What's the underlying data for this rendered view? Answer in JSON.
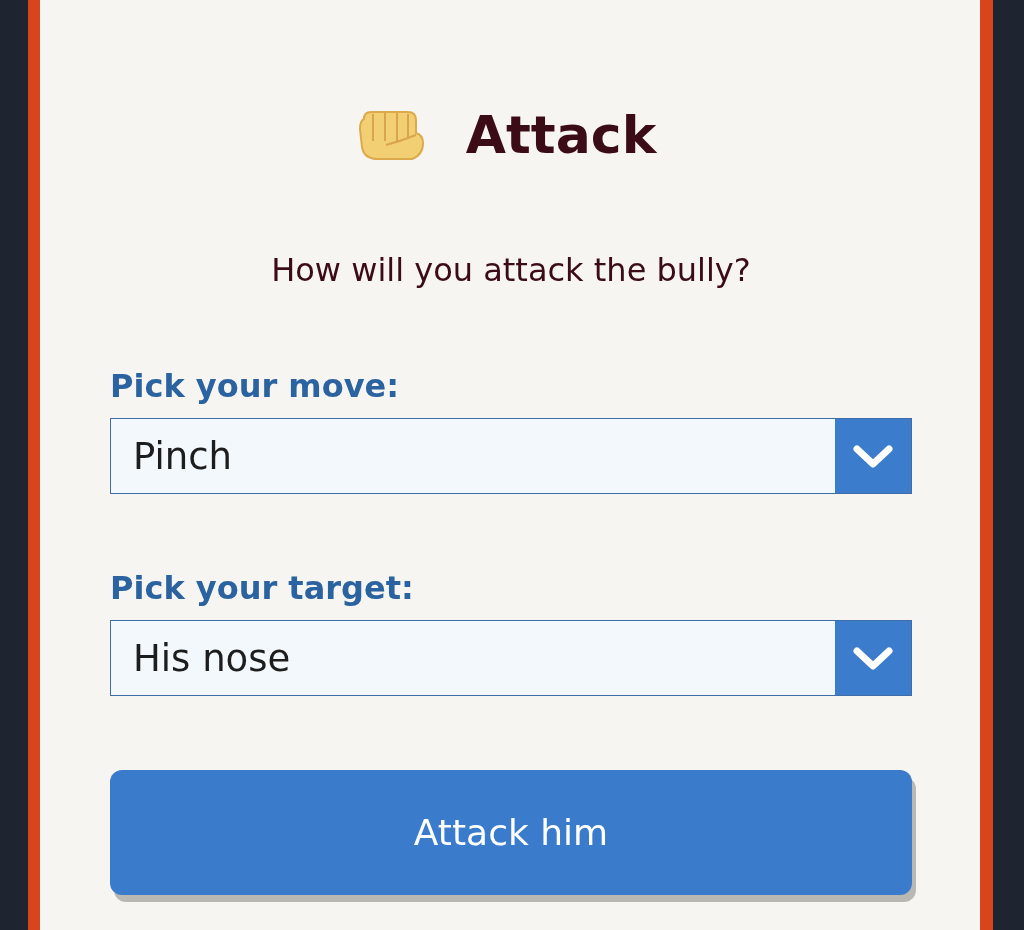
{
  "dialog": {
    "title": "Attack",
    "prompt": "How will you attack the bully?"
  },
  "fields": [
    {
      "label": "Pick your move:",
      "value": "Pinch"
    },
    {
      "label": "Pick your target:",
      "value": "His nose"
    }
  ],
  "submit_button": {
    "label": "Attack him"
  }
}
